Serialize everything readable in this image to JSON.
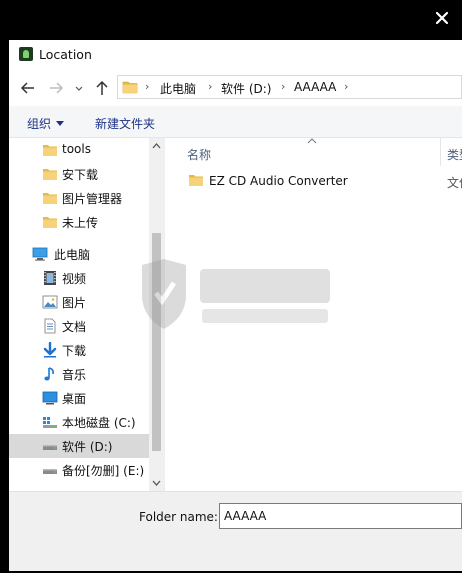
{
  "window": {
    "title": "Location"
  },
  "address": {
    "segments": [
      "此电脑",
      "软件 (D:)",
      "AAAAA"
    ]
  },
  "toolbar": {
    "organize_label": "组织",
    "new_folder_label": "新建文件夹"
  },
  "nav": {
    "items": [
      {
        "label": "tools",
        "icon": "folder-icon"
      },
      {
        "label": "安下载",
        "icon": "folder-icon"
      },
      {
        "label": "图片管理器",
        "icon": "folder-icon"
      },
      {
        "label": "未上传",
        "icon": "folder-icon"
      },
      {
        "label": "此电脑",
        "icon": "computer-icon"
      },
      {
        "label": "视频",
        "icon": "video-icon"
      },
      {
        "label": "图片",
        "icon": "pictures-icon"
      },
      {
        "label": "文档",
        "icon": "documents-icon"
      },
      {
        "label": "下载",
        "icon": "download-icon"
      },
      {
        "label": "音乐",
        "icon": "music-icon"
      },
      {
        "label": "桌面",
        "icon": "desktop-icon"
      },
      {
        "label": "本地磁盘 (C:)",
        "icon": "drive-icon"
      },
      {
        "label": "软件 (D:)",
        "icon": "drive-icon",
        "selected": true
      },
      {
        "label": "备份[勿删] (E:)",
        "icon": "drive-icon"
      }
    ]
  },
  "files": {
    "column_name": "名称",
    "column_type": "类型",
    "rows": [
      {
        "name": "EZ CD Audio Converter",
        "type": "文件"
      }
    ]
  },
  "footer": {
    "folder_name_label": "Folder name:",
    "folder_name_value": "AAAAA"
  },
  "colors": {
    "command_text": "#1e3287",
    "selected_nav": "#d9d9d9",
    "folder": "#e8b84a"
  }
}
